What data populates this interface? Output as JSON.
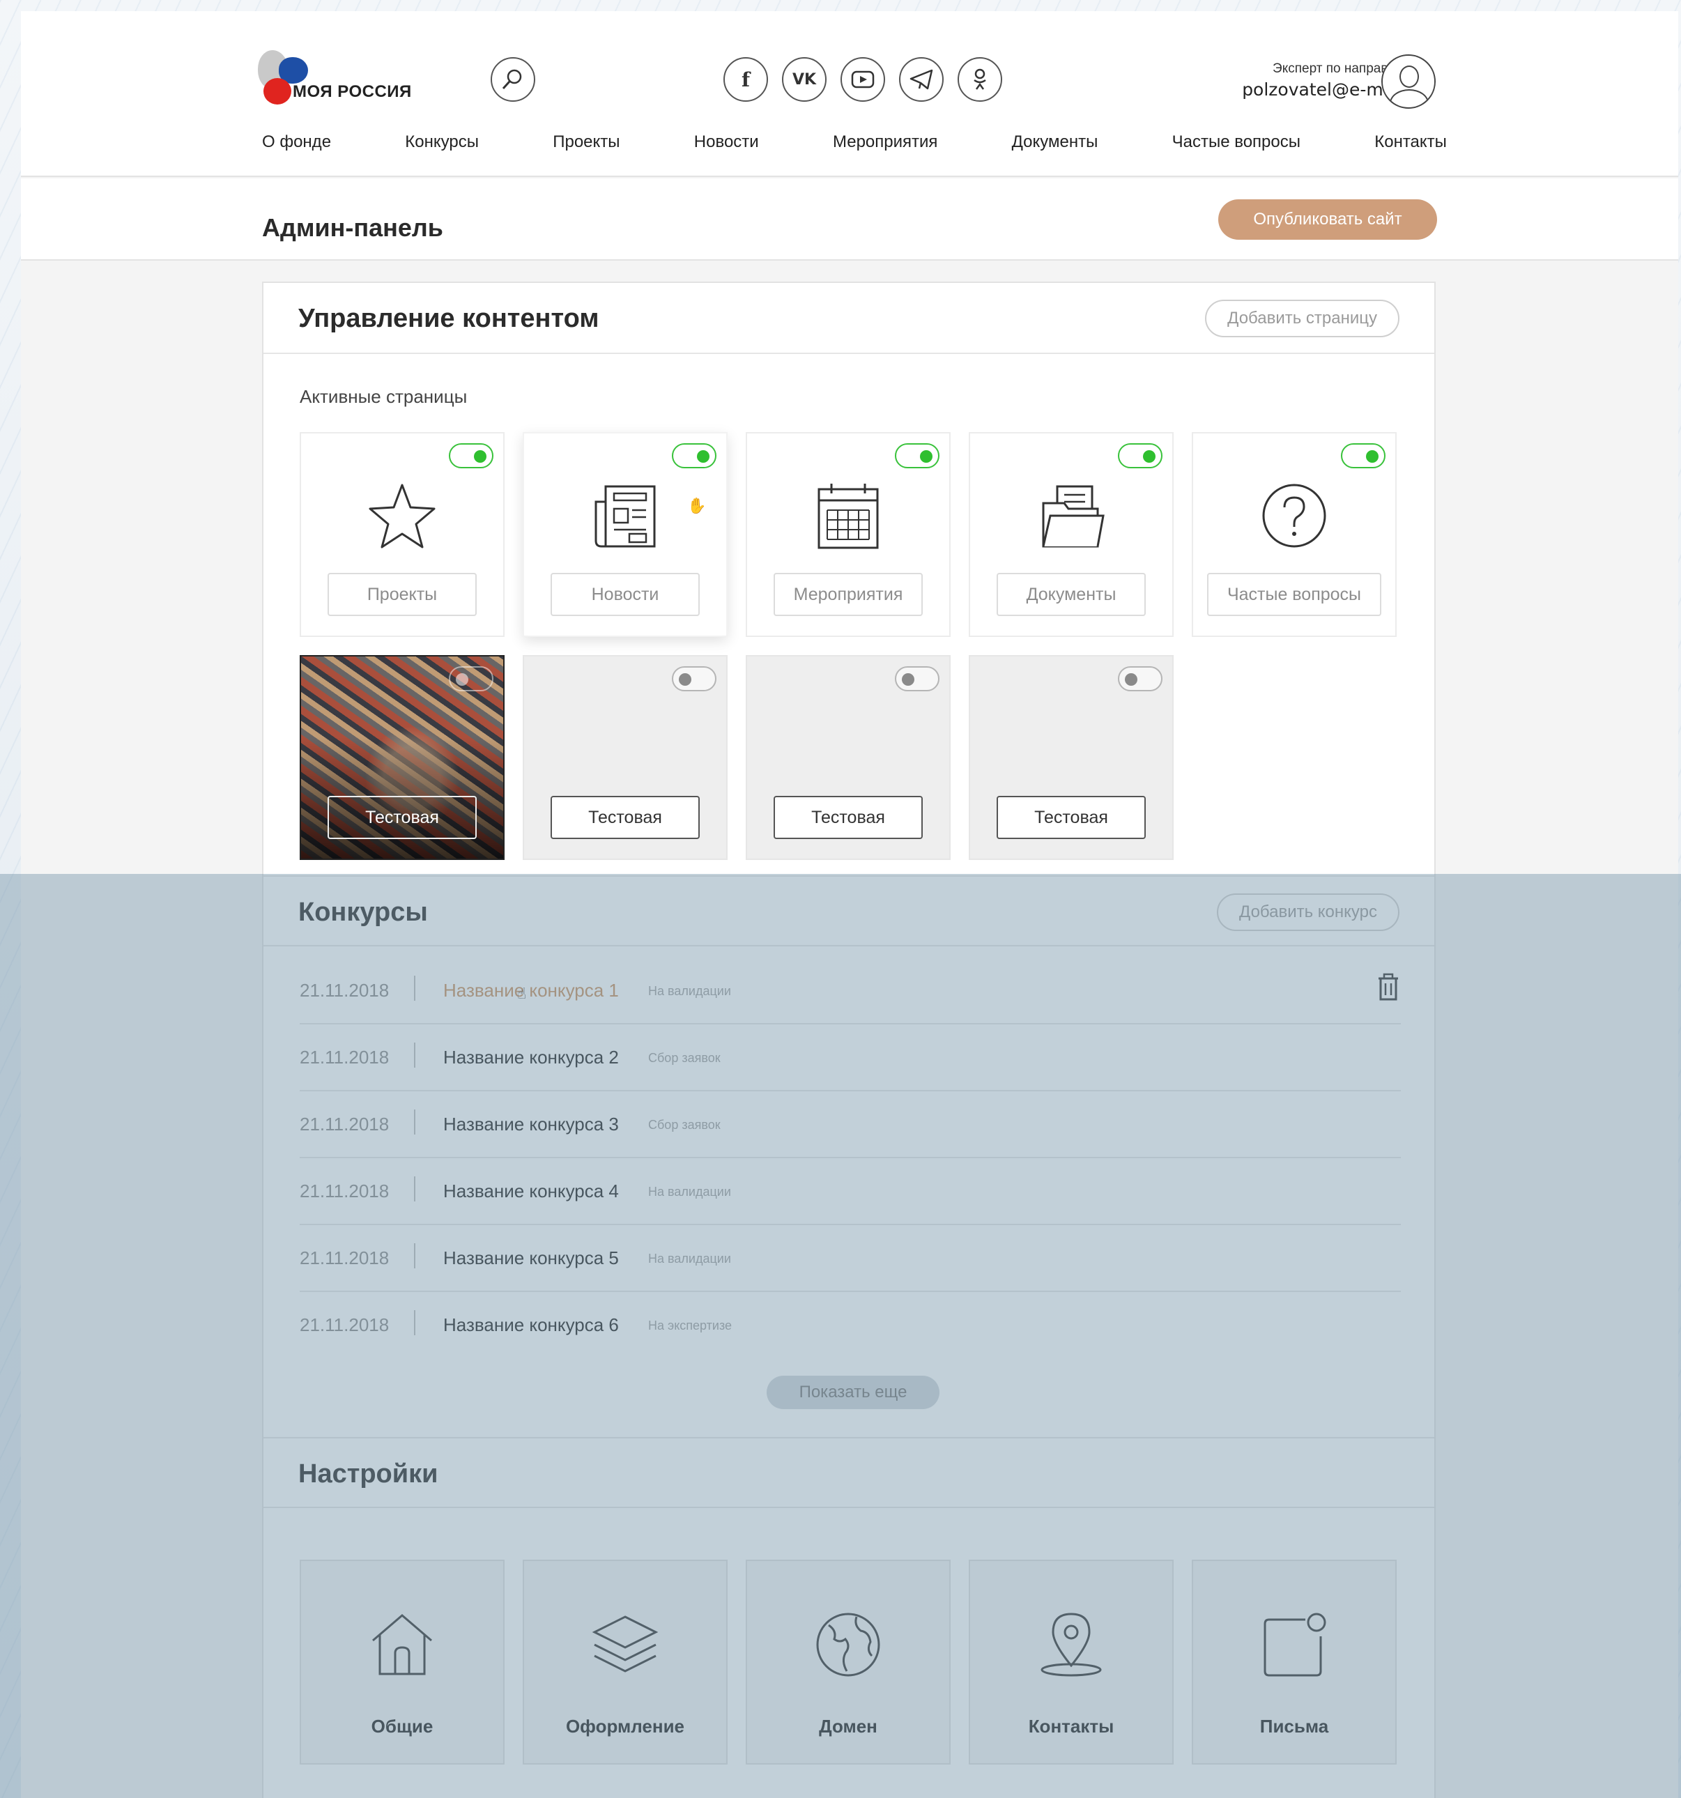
{
  "brand": {
    "logo_text": "МОЯ РОССИЯ"
  },
  "header": {
    "user_role": "Эксперт по направлению",
    "user_email": "polzovatel@e-mail.ru",
    "social_icons": [
      "facebook-icon",
      "vk-icon",
      "youtube-icon",
      "telegram-icon",
      "odnoklassniki-icon"
    ]
  },
  "nav": [
    "О фонде",
    "Конкурсы",
    "Проекты",
    "Новости",
    "Мероприятия",
    "Документы",
    "Частые вопросы",
    "Контакты"
  ],
  "admin": {
    "title": "Админ-панель",
    "publish_label": "Опубликовать сайт"
  },
  "content": {
    "title": "Управление контентом",
    "add_page_label": "Добавить страницу",
    "active_pages_label": "Активные страницы",
    "pages": [
      {
        "label": "Проекты",
        "icon": "star-icon",
        "enabled": true
      },
      {
        "label": "Новости",
        "icon": "newspaper-icon",
        "enabled": true
      },
      {
        "label": "Мероприятия",
        "icon": "calendar-icon",
        "enabled": true
      },
      {
        "label": "Документы",
        "icon": "folder-icon",
        "enabled": true
      },
      {
        "label": "Частые вопросы",
        "icon": "question-icon",
        "enabled": true
      }
    ],
    "test_pages": [
      {
        "label": "Тестовая",
        "enabled": false
      },
      {
        "label": "Тестовая",
        "enabled": false
      },
      {
        "label": "Тестовая",
        "enabled": false
      },
      {
        "label": "Тестовая",
        "enabled": false
      }
    ]
  },
  "contests": {
    "title": "Конкурсы",
    "add_label": "Добавить конкурс",
    "rows": [
      {
        "date": "21.11.2018",
        "name": "Название конкурса 1",
        "status": "На валидации"
      },
      {
        "date": "21.11.2018",
        "name": "Название конкурса 2",
        "status": "Сбор заявок"
      },
      {
        "date": "21.11.2018",
        "name": "Название конкурса 3",
        "status": "Сбор заявок"
      },
      {
        "date": "21.11.2018",
        "name": "Название конкурса 4",
        "status": "На валидации"
      },
      {
        "date": "21.11.2018",
        "name": "Название конкурса 5",
        "status": "На валидации"
      },
      {
        "date": "21.11.2018",
        "name": "Название конкурса 6",
        "status": "На экспертизе"
      }
    ],
    "more_label": "Показать еще"
  },
  "settings": {
    "title": "Настройки",
    "items": [
      {
        "label": "Общие",
        "icon": "home-icon"
      },
      {
        "label": "Оформление",
        "icon": "layers-icon"
      },
      {
        "label": "Домен",
        "icon": "globe-icon"
      },
      {
        "label": "Контакты",
        "icon": "map-pin-icon"
      },
      {
        "label": "Письма",
        "icon": "mail-notification-icon"
      }
    ]
  },
  "colors": {
    "accent": "#cf9e7b",
    "toggle_on": "#2fbf2f",
    "highlight_link": "#c9905f"
  }
}
